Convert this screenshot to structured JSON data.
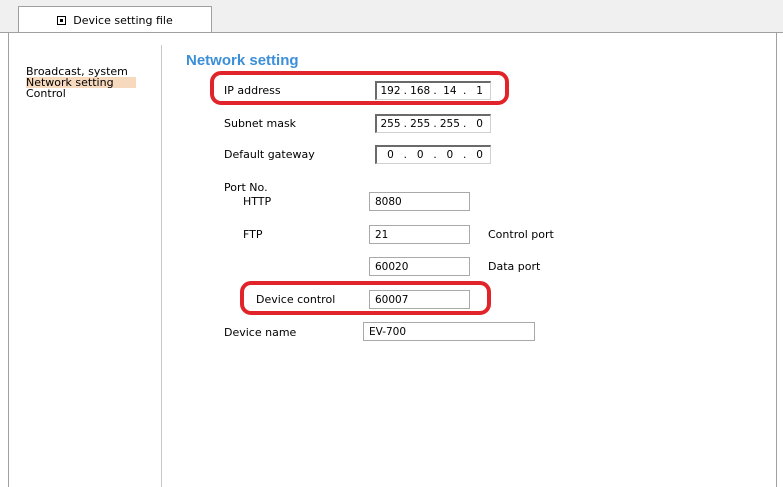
{
  "tab": {
    "label": "Device setting file"
  },
  "nav": {
    "items": [
      {
        "label": "Broadcast, system"
      },
      {
        "label": "Network setting"
      },
      {
        "label": "Control"
      }
    ]
  },
  "page": {
    "title": "Network setting"
  },
  "fields": {
    "ip_address": {
      "label": "IP address",
      "octets": [
        "192",
        "168",
        "14",
        "1"
      ]
    },
    "subnet_mask": {
      "label": "Subnet mask",
      "octets": [
        "255",
        "255",
        "255",
        "0"
      ]
    },
    "default_gateway": {
      "label": "Default gateway",
      "octets": [
        "0",
        "0",
        "0",
        "0"
      ]
    },
    "port_no": {
      "label": "Port No."
    },
    "http": {
      "label": "HTTP",
      "value": "8080"
    },
    "ftp": {
      "label": "FTP",
      "value": "21",
      "note": "Control port"
    },
    "ftp_data": {
      "value": "60020",
      "note": "Data port"
    },
    "device_control": {
      "label": "Device control",
      "value": "60007"
    },
    "device_name": {
      "label": "Device name",
      "value": "EV-700"
    }
  },
  "highlight_color": "#e0242a",
  "title_color": "#3b8fd9",
  "icons": {
    "tab": "document-settings-icon"
  }
}
